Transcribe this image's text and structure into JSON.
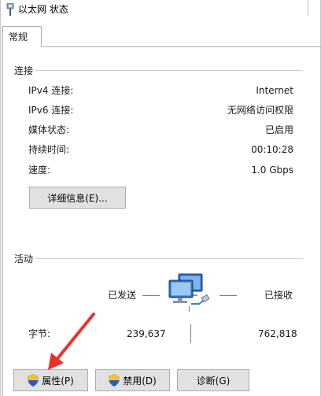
{
  "window": {
    "title": "以太网 状态"
  },
  "tabs": [
    {
      "label": "常规"
    }
  ],
  "connection": {
    "section_label": "连接",
    "rows": [
      {
        "label": "IPv4 连接:",
        "value": "Internet"
      },
      {
        "label": "IPv6 连接:",
        "value": "无网络访问权限"
      },
      {
        "label": "媒体状态:",
        "value": "已启用"
      },
      {
        "label": "持续时间:",
        "value": "00:10:28"
      },
      {
        "label": "速度:",
        "value": "1.0 Gbps"
      }
    ],
    "details_button": "详细信息(E)..."
  },
  "activity": {
    "section_label": "活动",
    "sent_label": "已发送",
    "received_label": "已接收",
    "bytes_label": "字节:",
    "bytes_sent": "239,637",
    "bytes_received": "762,818",
    "icon": "network-computers-icon"
  },
  "buttons": {
    "properties": "属性(P)",
    "disable": "禁用(D)",
    "diagnose": "诊断(G)"
  },
  "colors": {
    "annotation_arrow": "#e8322b",
    "button_bg": "#e1e1e1",
    "shield_blue": "#2a5db8",
    "shield_yellow": "#f2c230"
  }
}
